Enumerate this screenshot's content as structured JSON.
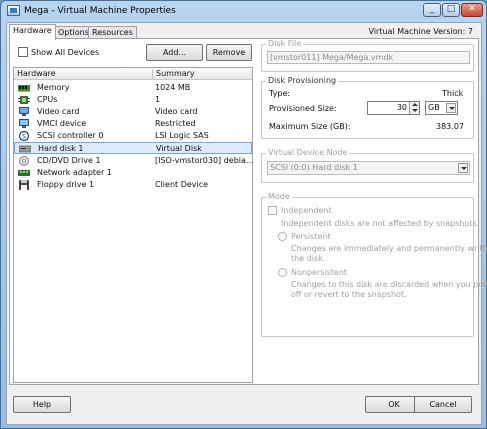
{
  "window": {
    "title": "Mega - Virtual Machine Properties",
    "minimize_icon": "minimize-icon",
    "maximize_icon": "maximize-icon",
    "close_icon": "close-icon"
  },
  "tabs": [
    {
      "label": "Hardware",
      "active": true
    },
    {
      "label": "Options",
      "active": false
    },
    {
      "label": "Resources",
      "active": false
    }
  ],
  "vm_version": "Virtual Machine Version: 7",
  "hardware_panel": {
    "show_all_devices_label": "Show All Devices",
    "show_all_devices_checked": false,
    "add_button": "Add...",
    "remove_button": "Remove",
    "columns": [
      "Hardware",
      "Summary"
    ],
    "rows": [
      {
        "name": "Memory",
        "summary": "1024 MB",
        "icon": "memory-icon"
      },
      {
        "name": "CPUs",
        "summary": "1",
        "icon": "cpu-icon"
      },
      {
        "name": "Video card",
        "summary": "Video card",
        "icon": "video-card-icon"
      },
      {
        "name": "VMCI device",
        "summary": "Restricted",
        "icon": "vmci-device-icon"
      },
      {
        "name": "SCSI controller 0",
        "summary": "LSI Logic SAS",
        "icon": "scsi-controller-icon"
      },
      {
        "name": "Hard disk 1",
        "summary": "Virtual Disk",
        "icon": "hard-disk-icon",
        "selected": true
      },
      {
        "name": "CD/DVD Drive 1",
        "summary": "[ISO-vmstor030] debia...",
        "icon": "cd-dvd-drive-icon"
      },
      {
        "name": "Network adapter 1",
        "summary": "",
        "icon": "network-adapter-icon"
      },
      {
        "name": "Floppy drive 1",
        "summary": "Client Device",
        "icon": "floppy-drive-icon"
      }
    ]
  },
  "disk_file": {
    "label": "Disk File",
    "value": "[vmstor011] Mega/Mega.vmdk"
  },
  "disk_provisioning": {
    "label": "Disk Provisioning",
    "type_label": "Type:",
    "type_value": "Thick",
    "provisioned_size_label": "Provisioned Size:",
    "provisioned_size_value": "30",
    "provisioned_unit": "GB",
    "max_size_label": "Maximum Size (GB):",
    "max_size_value": "383.07"
  },
  "virtual_device_node": {
    "label": "Virtual Device Node",
    "value": "SCSI (0:0) Hard disk 1"
  },
  "mode": {
    "label": "Mode",
    "independent_label": "Independent",
    "independent_desc": "Independent disks are not affected by snapshots.",
    "persistent_label": "Persistent",
    "persistent_desc_1": "Changes are immediately and permanently written to",
    "persistent_desc_2": "the disk.",
    "nonpersistent_label": "Nonpersistent",
    "nonpersistent_desc_1": "Changes to this disk are discarded when you power",
    "nonpersistent_desc_2": "off or revert to the snapshot."
  },
  "footer": {
    "help_button": "Help",
    "ok_button": "OK",
    "cancel_button": "Cancel"
  },
  "colors": {
    "selection": "#dcecfc",
    "titlebar": "#98bde0",
    "close_button": "#c8473a"
  }
}
